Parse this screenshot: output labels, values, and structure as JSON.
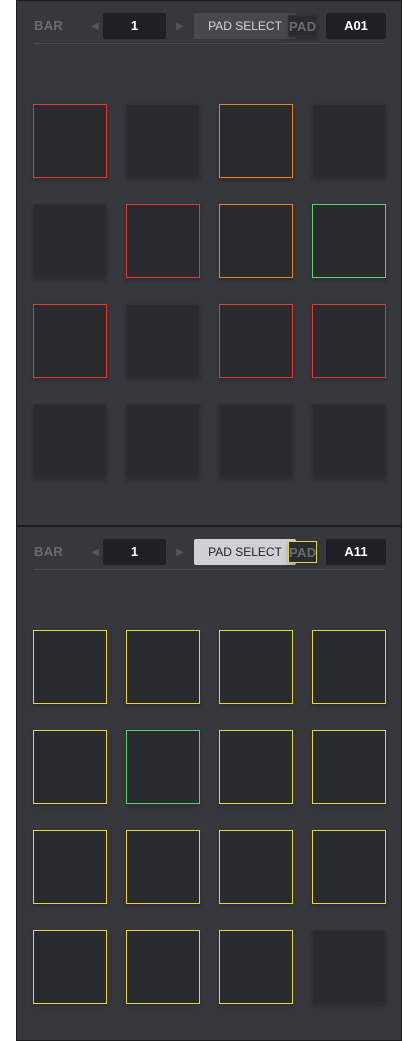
{
  "colors": {
    "panel_bg": "#37383d",
    "pad_bg": "#2a2b2f",
    "red": "#e23a2e",
    "orange": "#e8802a",
    "green": "#55d66a",
    "yellow": "#e5d43a"
  },
  "panels": [
    {
      "header": {
        "bar_label": "BAR",
        "bar_value": "1",
        "pad_select_label": "PAD SELECT",
        "pad_select_active": false,
        "pad_label": "PAD",
        "pad_value": "A01"
      },
      "pad_states": [
        "none",
        "red",
        "none",
        "orange",
        "none",
        "none",
        "red",
        "orange",
        "green",
        "red",
        "none",
        "red",
        "red",
        "none",
        "none",
        "none"
      ]
    },
    {
      "header": {
        "bar_label": "BAR",
        "bar_value": "1",
        "pad_select_label": "PAD SELECT",
        "pad_select_active": true,
        "pad_label": "PAD",
        "pad_value": "A11"
      },
      "pad_states": [
        "yellow",
        "yellow",
        "yellow",
        "yellow",
        "yellow",
        "yellow",
        "green",
        "yellow",
        "yellow",
        "yellow",
        "yellow",
        "yellow",
        "yellow",
        "yellow",
        "yellow",
        "yellow"
      ]
    }
  ]
}
